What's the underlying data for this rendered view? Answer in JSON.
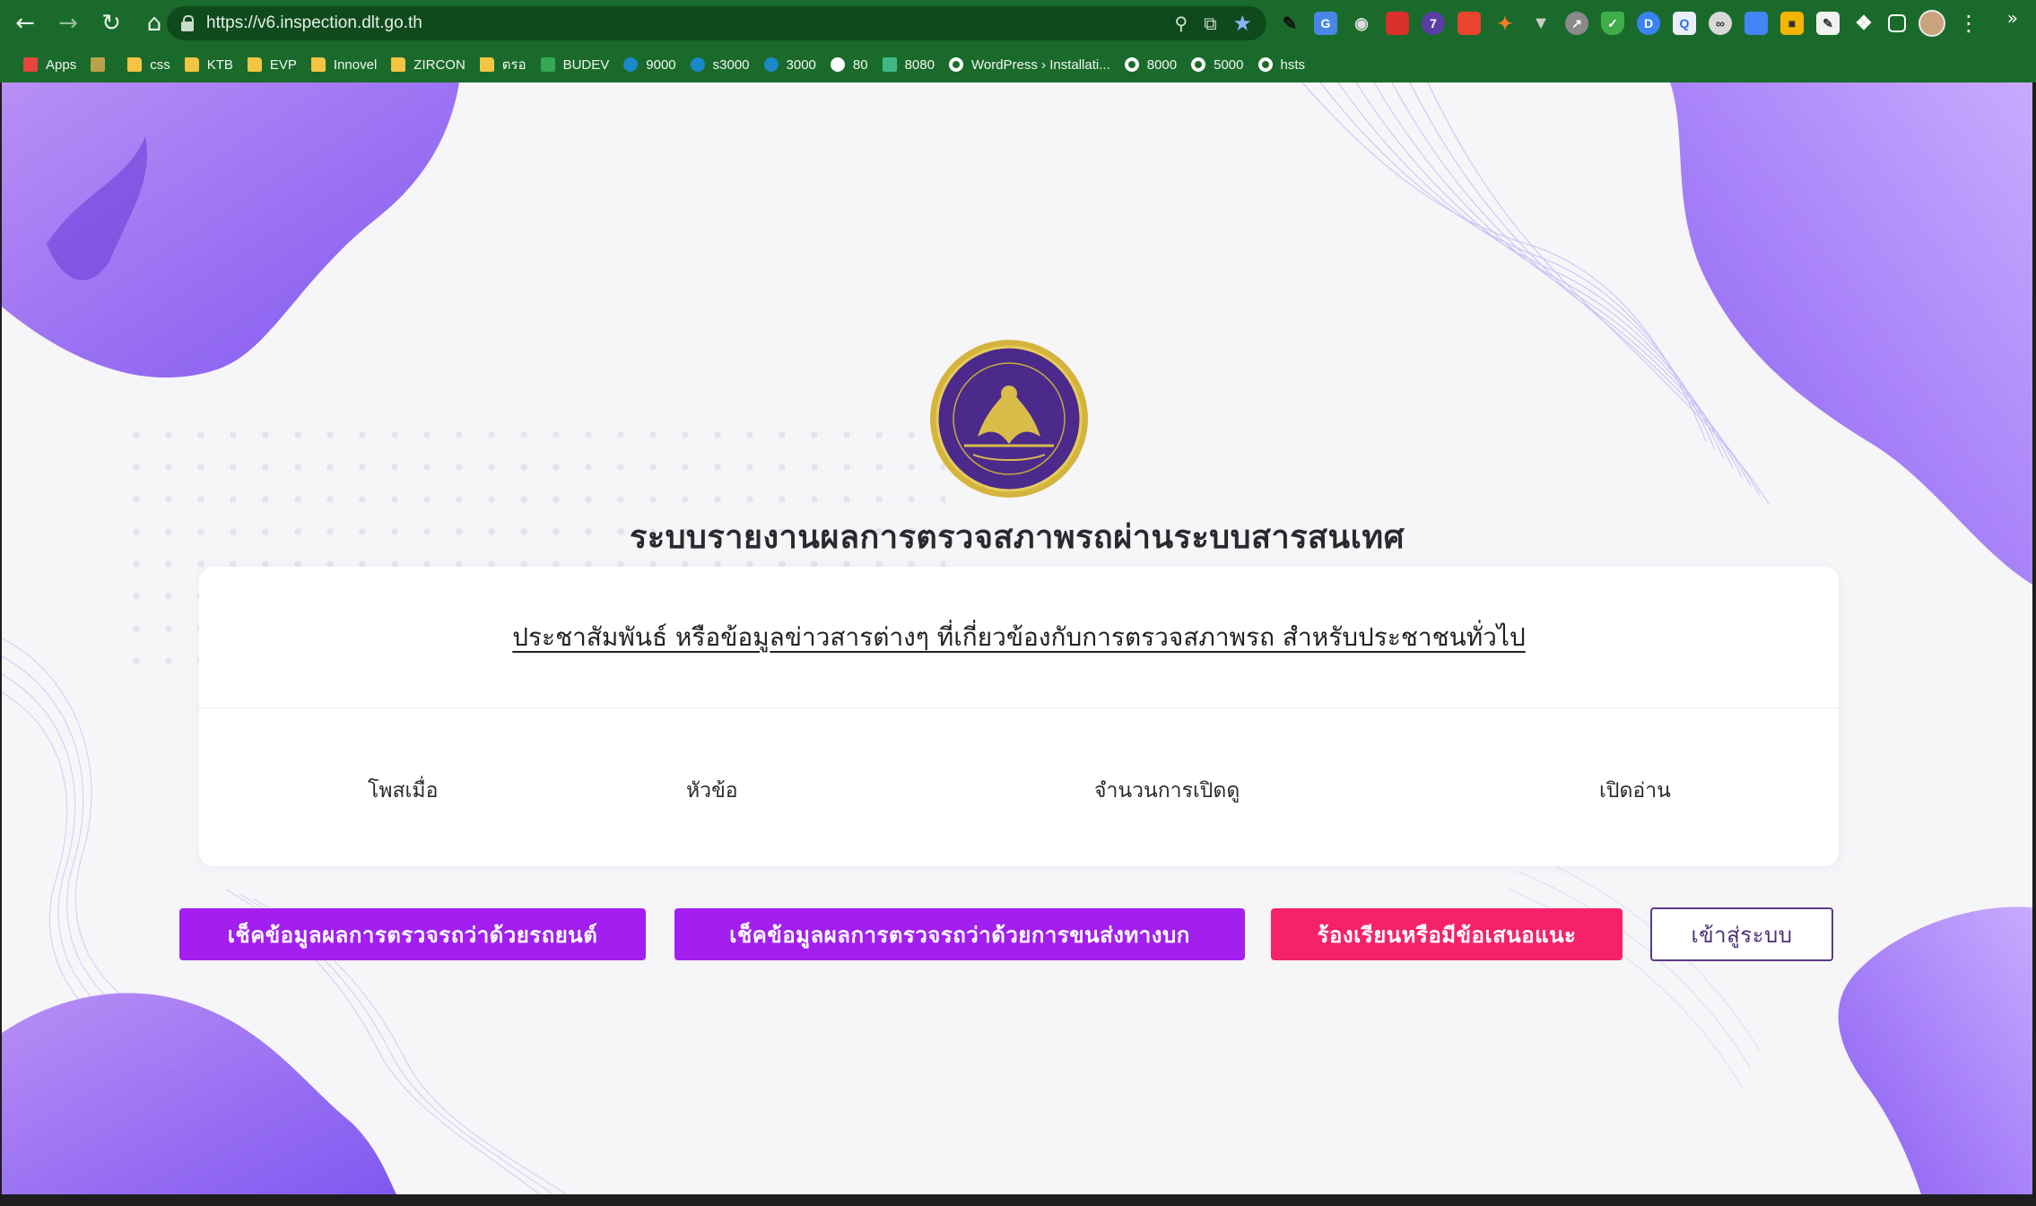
{
  "browser": {
    "url": "https://v6.inspection.dlt.go.th",
    "bookmarks": [
      {
        "label": "Apps",
        "icon": "apps-grid-icon"
      },
      {
        "label": "",
        "icon": "cube-icon"
      },
      {
        "label": "css",
        "icon": "folder-icon"
      },
      {
        "label": "KTB",
        "icon": "folder-icon"
      },
      {
        "label": "EVP",
        "icon": "folder-icon"
      },
      {
        "label": "Innovel",
        "icon": "folder-icon"
      },
      {
        "label": "ZIRCON",
        "icon": "folder-icon"
      },
      {
        "label": "ตรอ",
        "icon": "folder-icon"
      },
      {
        "label": "BUDEV",
        "icon": "drive-icon"
      },
      {
        "label": "9000",
        "icon": "site-icon"
      },
      {
        "label": "s3000",
        "icon": "site-icon"
      },
      {
        "label": "3000",
        "icon": "site-icon"
      },
      {
        "label": "80",
        "icon": "wordpress-icon"
      },
      {
        "label": "8080",
        "icon": "vue-icon"
      },
      {
        "label": "WordPress › Installati...",
        "icon": "globe-icon"
      },
      {
        "label": "8000",
        "icon": "globe-icon"
      },
      {
        "label": "5000",
        "icon": "globe-icon"
      },
      {
        "label": "hsts",
        "icon": "globe-icon"
      }
    ],
    "more_label": "»"
  },
  "page": {
    "title": "ระบบรายงานผลการตรวจสภาพรถผ่านระบบสารสนเทศ",
    "announcement_link": "ประชาสัมพันธ์ หรือข้อมูลข่าวสารต่างๆ ที่เกี่ยวข้องกับการตรวจสภาพรถ สำหรับประชาชนทั่วไป",
    "table_headers": [
      "โพสเมื่อ",
      "หัวข้อ",
      "จำนวนการเปิดดู",
      "เปิดอ่าน"
    ],
    "buttons": {
      "check_car": "เช็คข้อมูลผลการตรวจรถว่าด้วยรถยนต์",
      "check_transport": "เช็คข้อมูลผลการตรวจรถว่าด้วยการขนส่งทางบก",
      "complaint": "ร้องเรียนหรือมีข้อเสนอแนะ",
      "login": "เข้าสู่ระบบ"
    }
  },
  "colors": {
    "chrome_green": "#1a6b2b",
    "primary_purple": "#a21ff0",
    "accent_pink": "#f5226a",
    "blob_purple": "#8b5cf6"
  }
}
